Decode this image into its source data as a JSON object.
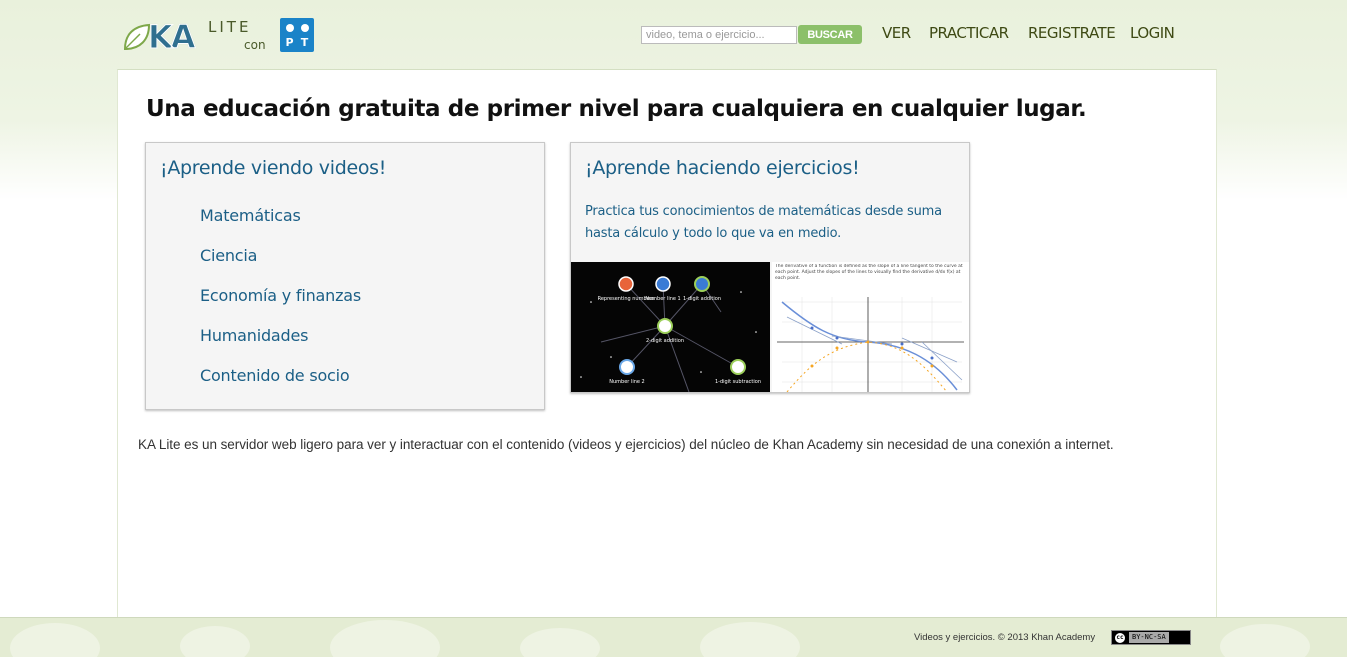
{
  "header": {
    "logo": {
      "ka": "KA",
      "lite": "LITE",
      "con": "con",
      "partner": [
        "",
        "",
        "P",
        "T"
      ]
    },
    "search": {
      "placeholder": "video, tema o ejercicio...",
      "button": "BUSCAR"
    },
    "nav": [
      "VER",
      "PRACTICAR",
      "REGISTRATE",
      "LOGIN"
    ]
  },
  "main": {
    "headline": "Una educación gratuita de primer nivel para cualquiera en cualquier lugar.",
    "videos_card": {
      "title": "¡Aprende viendo videos!",
      "links": [
        "Matemáticas",
        "Ciencia",
        "Economía y finanzas",
        "Humanidades",
        "Contenido de socio"
      ]
    },
    "exercises_card": {
      "title": "¡Aprende haciendo ejercicios!",
      "description": "Practica tus conocimientos de matemáticas desde suma hasta cálculo y todo lo que va en medio.",
      "map_nodes": [
        "Representing numbers",
        "Number line 1",
        "1-digit addition",
        "2-digit addition",
        "Number line 2",
        "1-digit subtraction"
      ],
      "graph_caption": "The derivative of a function is defined as the slope of a line tangent to the curve at each point. Adjust the slopes of the lines to visually find the derivative d/dx f(x) at each point."
    },
    "about": "KA Lite es un servidor web ligero para ver y interactuar con el contenido (videos y ejercicios) del núcleo de Khan Academy sin necesidad de una conexión a internet."
  },
  "footer": {
    "copyright": "Videos y ejercicios. © 2013 Khan Academy",
    "license_badge": {
      "cc": "cc",
      "text": "BY-NC-SA"
    }
  },
  "colors": {
    "link": "#1b5f86",
    "nav": "#3e4a14",
    "search_button": "#8cc06a",
    "header_bg": "#e9f1dc",
    "footer_bg": "#e4ecd3"
  }
}
